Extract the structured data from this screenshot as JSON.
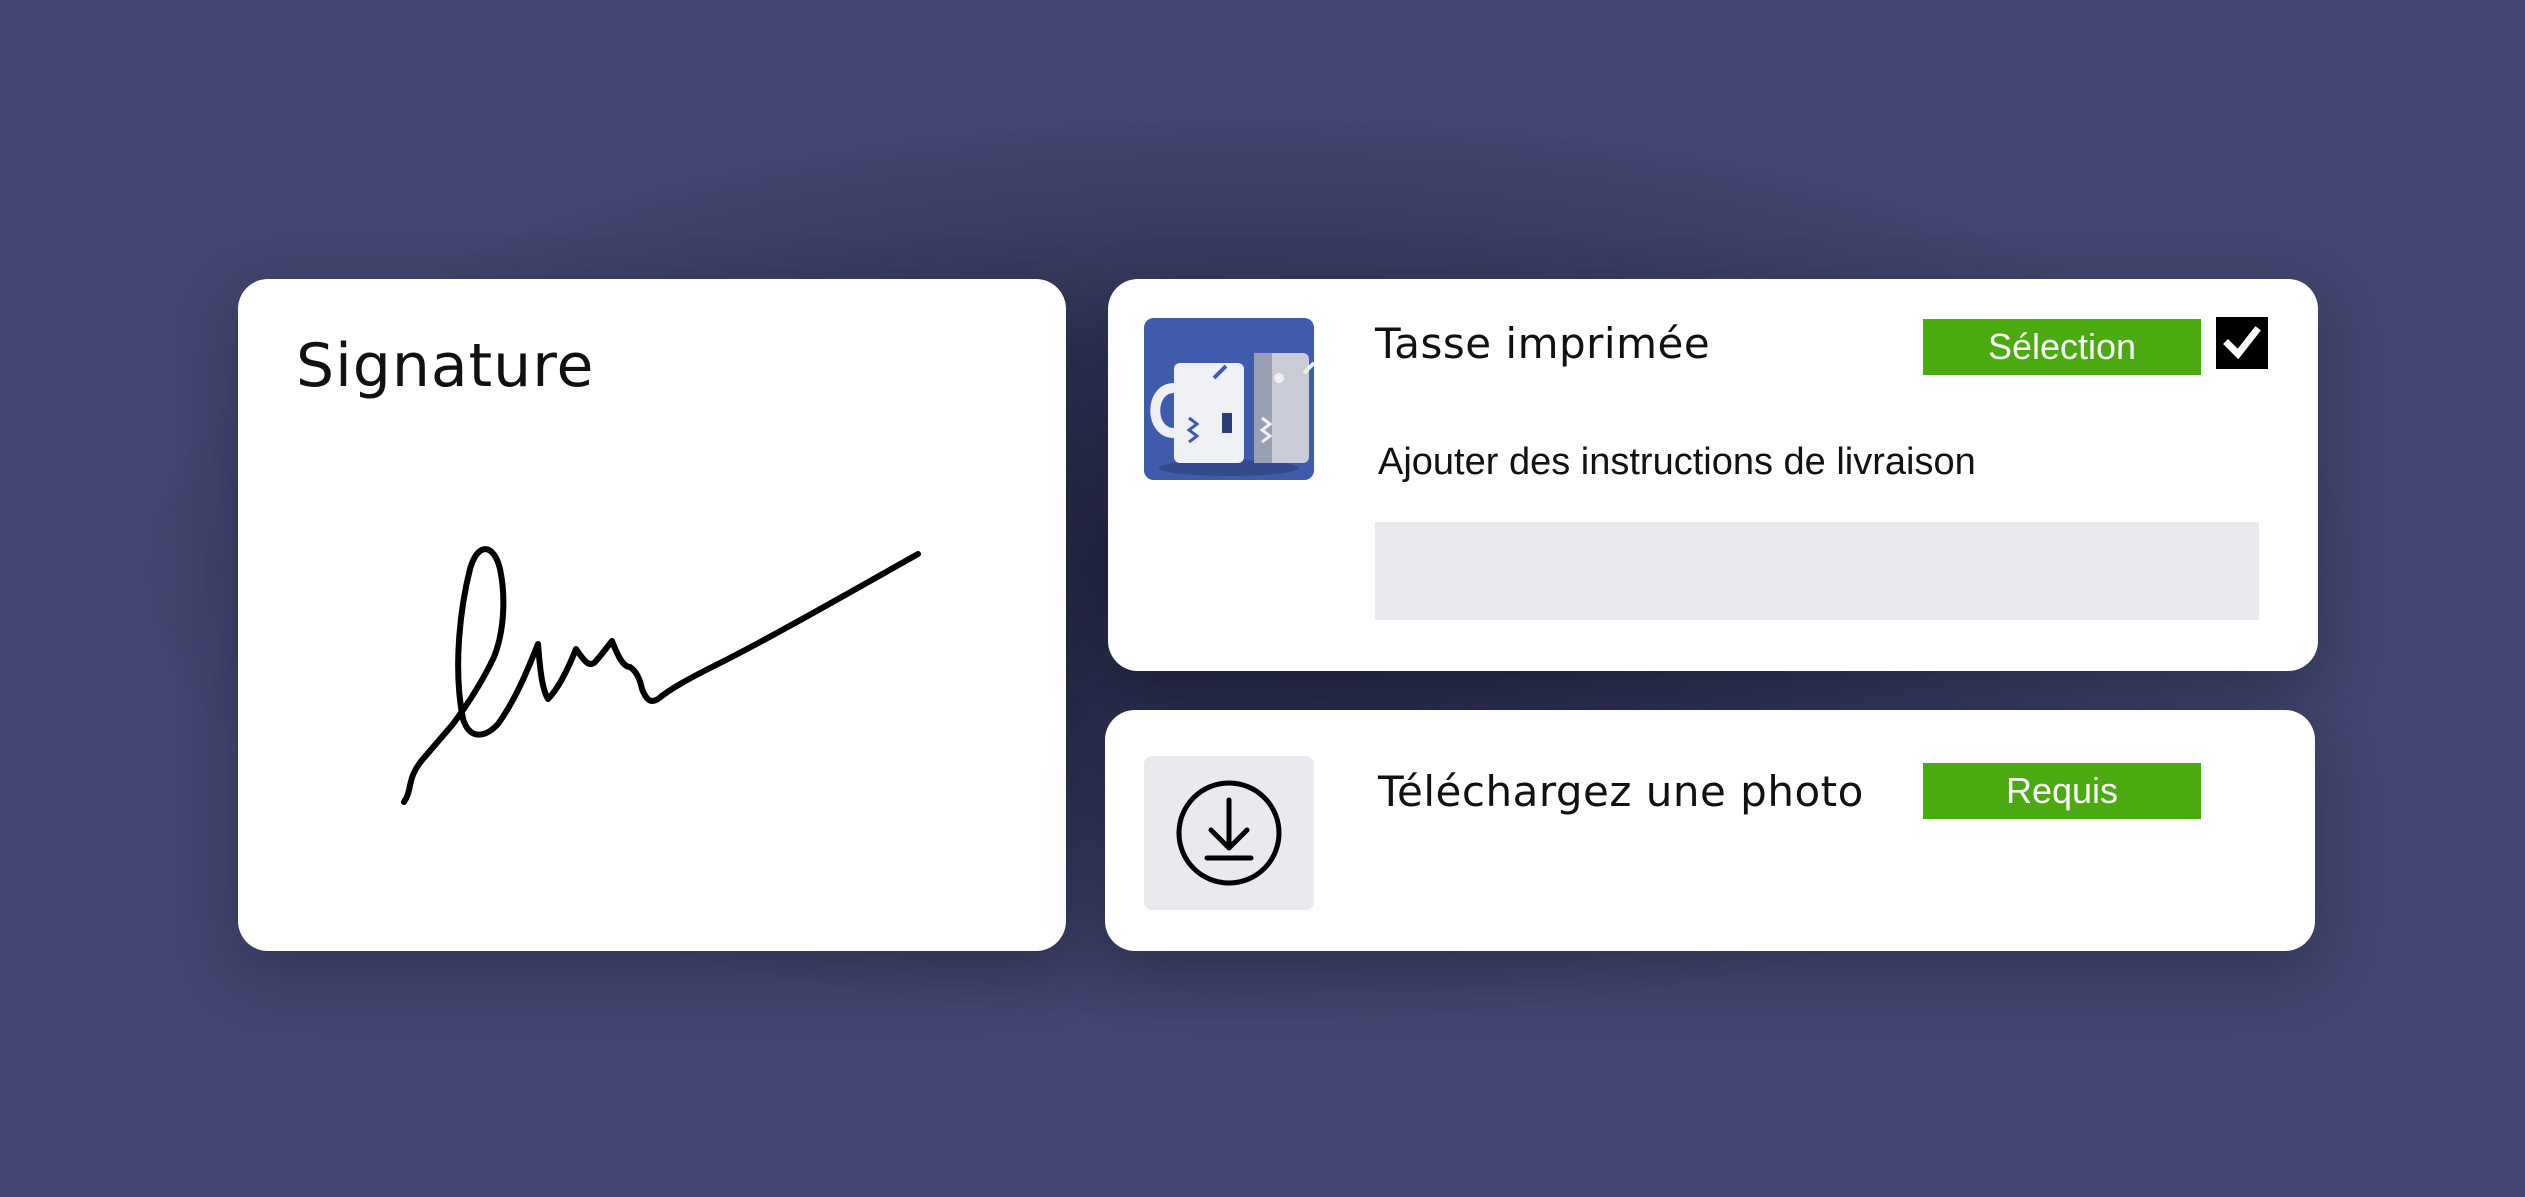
{
  "signature_card": {
    "title": "Signature"
  },
  "product_card": {
    "name": "Tasse imprimée",
    "thumbnail": "mug-photo",
    "select_badge": "Sélection",
    "checkbox_checked": true,
    "delivery_label": "Ajouter des instructions de livraison",
    "delivery_value": ""
  },
  "upload_card": {
    "label": "Téléchargez une photo",
    "required_badge": "Requis",
    "icon": "download-circle-icon"
  },
  "colors": {
    "background": "#424670",
    "accent_green": "#4aaa0f",
    "input_gray": "#e8eaee",
    "thumbnail_blue": "#3f5bab"
  }
}
